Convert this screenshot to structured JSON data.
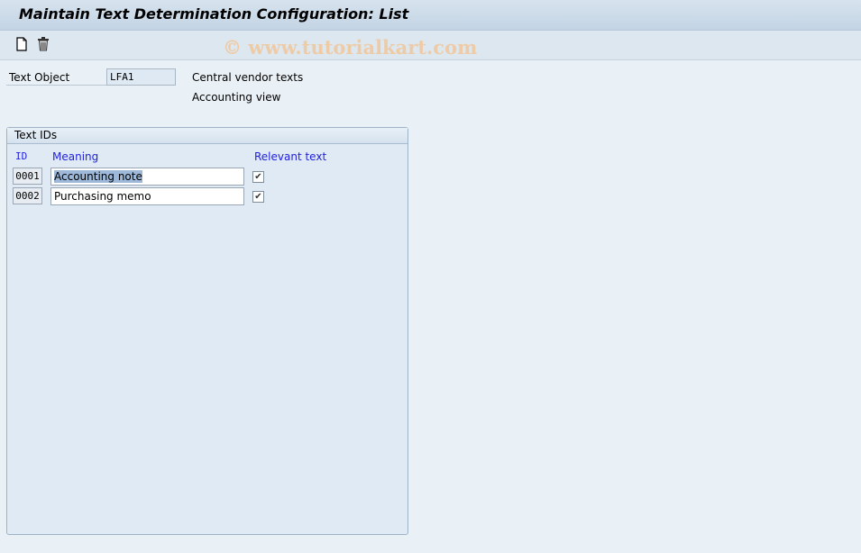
{
  "title": "Maintain Text Determination Configuration: List",
  "toolbar": {
    "new_icon": "new-document-icon",
    "delete_icon": "trash-icon"
  },
  "watermark": "© www.tutorialkart.com",
  "header": {
    "text_object_label": "Text Object",
    "text_object_value": "LFA1",
    "description1": "Central vendor texts",
    "description2": "Accounting view"
  },
  "group": {
    "title": "Text IDs",
    "columns": [
      "ID",
      "Meaning",
      "Relevant text"
    ],
    "rows": [
      {
        "id": "0001",
        "meaning": "Accounting note",
        "relevant": true
      },
      {
        "id": "0002",
        "meaning": "Purchasing memo",
        "relevant": true
      }
    ]
  }
}
